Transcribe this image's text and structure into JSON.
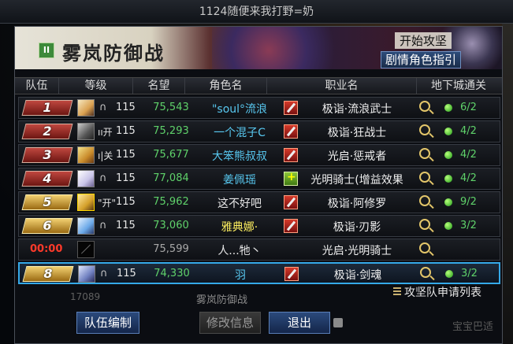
{
  "window": {
    "title": "1124随便来我打野=奶"
  },
  "banner": {
    "title": "雾岚防御战",
    "start_label": "开始攻坚",
    "story_button": "剧情角色指引",
    "icon": "pause-icon"
  },
  "table": {
    "headers": [
      "队伍",
      "等级",
      "名望",
      "角色名",
      "职业名",
      "地下城通关"
    ],
    "rows": [
      {
        "rank": "1",
        "badge": "red",
        "status_icon": "headset-icon",
        "status_text": "",
        "level": "115",
        "fame": "75,543",
        "name": "\"soul°流浪",
        "name_color": "blue",
        "job_icon": "sword-icon",
        "job": "极诣·流浪武士",
        "clear": "6/2"
      },
      {
        "rank": "2",
        "badge": "red",
        "status_icon": "",
        "status_text": "ıı开",
        "level": "115",
        "fame": "75,293",
        "name": "一个混子C",
        "name_color": "blue",
        "job_icon": "sword-icon",
        "job": "极诣·狂战士",
        "clear": "4/2"
      },
      {
        "rank": "3",
        "badge": "red",
        "status_icon": "",
        "status_text": "ı|关",
        "level": "115",
        "fame": "75,677",
        "name": "大笨熊叔叔",
        "name_color": "blue",
        "job_icon": "sword-icon",
        "job": "光启·惩戒者",
        "clear": "4/2"
      },
      {
        "rank": "4",
        "badge": "red",
        "status_icon": "headset-icon",
        "status_text": "",
        "level": "115",
        "fame": "77,084",
        "name": "姜佩瑶",
        "name_color": "blue",
        "job_icon": "holy-icon",
        "job": "光明骑士(增益效果",
        "clear": "4/2"
      },
      {
        "rank": "5",
        "badge": "gold",
        "status_icon": "",
        "status_text": "\"开\"",
        "level": "115",
        "fame": "75,962",
        "name": "这不好吧",
        "name_color": "white",
        "job_icon": "sword-icon",
        "job": "极诣·阿修罗",
        "clear": "9/2"
      },
      {
        "rank": "6",
        "badge": "gold",
        "status_icon": "headset-icon",
        "status_text": "",
        "level": "115",
        "fame": "73,060",
        "name": "雅典娜·",
        "name_color": "yellow",
        "job_icon": "sword-icon",
        "job": "极诣·刃影",
        "clear": "3/2"
      },
      {
        "rank": "",
        "timer": "00:00",
        "badge": "none",
        "status_icon": "",
        "status_text": "",
        "level": "",
        "fame": "75,599",
        "name": "人...牠丶",
        "name_color": "white",
        "job_icon": "",
        "job": "光启·光明骑士",
        "clear": ""
      },
      {
        "rank": "8",
        "badge": "gold",
        "status_icon": "headset-icon",
        "status_text": "",
        "level": "115",
        "fame": "74,330",
        "name": "羽",
        "name_color": "blue",
        "job_icon": "sword-icon",
        "job": "极诣·剑魂",
        "clear": "3/2",
        "selected": true
      }
    ]
  },
  "footer": {
    "info": "17089",
    "mode": "雾岚防御战",
    "queue_link": "攻坚队申请列表",
    "team_button": "队伍编制",
    "modify_button": "修改信息",
    "exit_button": "退出",
    "right_text": "宝宝巴适"
  },
  "colors": {
    "accent": "#35a9e8",
    "fame_green": "#5fd26a",
    "name_blue": "#58c8f0",
    "timer_red": "#ff3a2a"
  }
}
